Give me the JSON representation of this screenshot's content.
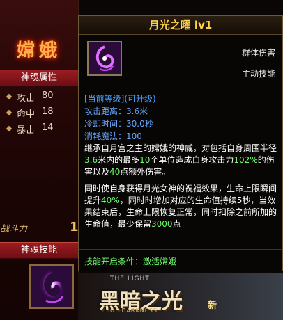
{
  "character": {
    "name": "嫦娥",
    "attr_section": "神魂属性",
    "attributes": [
      {
        "label": "攻击",
        "value": "80"
      },
      {
        "label": "命中",
        "value": "18"
      },
      {
        "label": "暴击",
        "value": "14"
      }
    ],
    "deco_text": "战斗力",
    "deco_digit": "1",
    "skill_section": "神魂技能"
  },
  "tooltip": {
    "title": "月光之曜 lv1",
    "type": "群体伤害",
    "kind": "主动技能",
    "level_tag": "[当前等级](可升级)",
    "stats": [
      {
        "label": "攻击距离：",
        "value": "3.6米"
      },
      {
        "label": "冷却时间：",
        "value": "30.0秒"
      },
      {
        "label": "消耗魔法：",
        "value": "100"
      }
    ],
    "desc1": {
      "a": "继承自月宫之主的嫦娥的神威，对包括自身周围半径",
      "n1": "3.6",
      "b": "米内的最多",
      "n2": "10",
      "c": "个单位造成自身攻击力",
      "n3": "102%",
      "d": "的伤害以及",
      "n4": "40",
      "e": "点额外伤害。"
    },
    "desc2": {
      "a": "同时使自身获得月光女神的祝福效果，生命上限瞬间提升",
      "n1": "40%",
      "b": "，同时时增加对应的生命值持续5秒，当效果结束后，生命上限恢复正常，同时扣除之前所加的生命值，最少保留",
      "n2": "3000",
      "c": "点"
    },
    "condition": "技能开启条件：激活嫦娥"
  },
  "logo": {
    "top": "THE LIGHT",
    "main": "黑暗之光",
    "sub": "OF DARKNESS",
    "new_badge": "新"
  },
  "colors": {
    "title": "#ffd24a",
    "stat_blue": "#6aa8ff",
    "highlight_green": "#6aff6a",
    "section_red": "#9b1c22"
  },
  "icons": {
    "skill": "purple-swirl-icon",
    "attribute_bullet": "diamond-bullet-icon"
  }
}
